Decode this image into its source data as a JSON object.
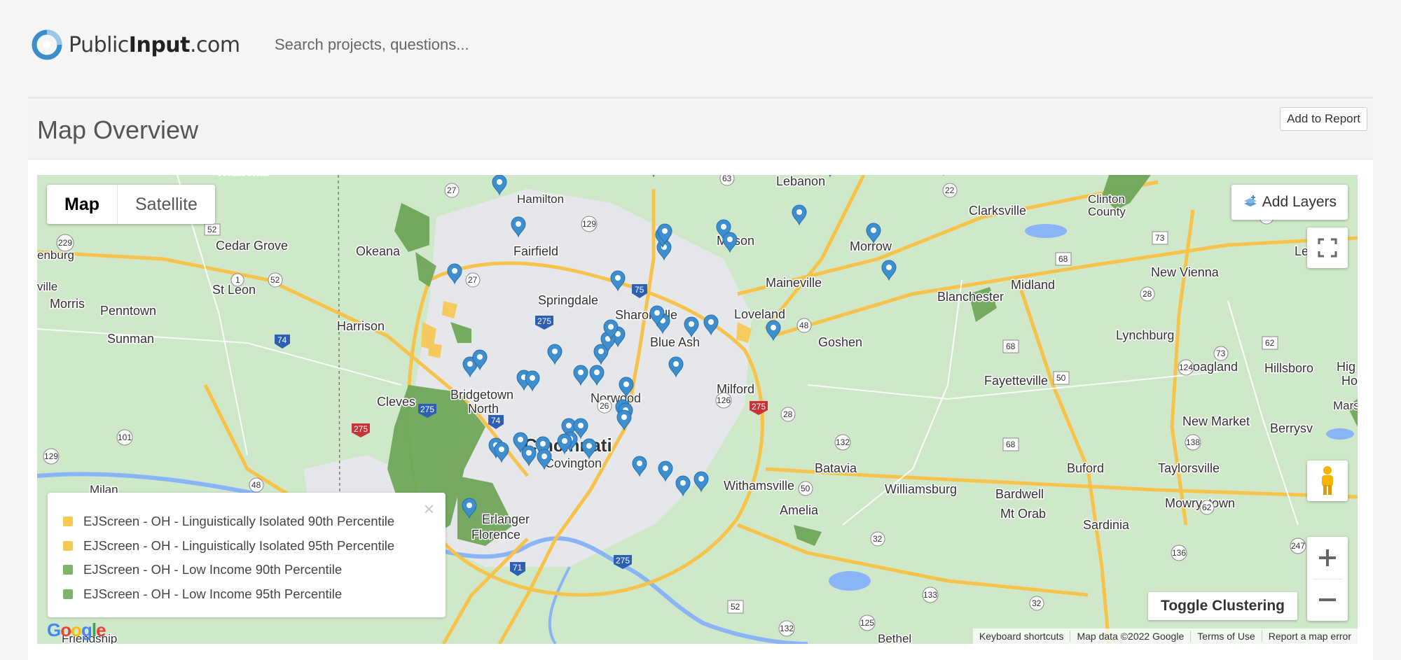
{
  "header": {
    "logo": {
      "prefix": "Public",
      "bold": "Input",
      "suffix": ".com"
    },
    "search_placeholder": "Search projects, questions..."
  },
  "card": {
    "title": "Map Overview",
    "add_to_report_label": "Add to Report"
  },
  "map": {
    "type_controls": {
      "map_label": "Map",
      "satellite_label": "Satellite",
      "active": "Map"
    },
    "add_layers_label": "Add Layers",
    "toggle_clustering_label": "Toggle Clustering",
    "zoom_in_icon": "plus-icon",
    "zoom_out_icon": "minus-icon",
    "fullscreen_icon": "fullscreen-icon",
    "pegman_icon": "pegman-icon",
    "legend": {
      "close_glyph": "×",
      "items": [
        {
          "label": "EJScreen - OH - Linguistically Isolated 90th Percentile",
          "color": "#f6c955"
        },
        {
          "label": "EJScreen - OH - Linguistically Isolated 95th Percentile",
          "color": "#f6c955"
        },
        {
          "label": "EJScreen - OH - Low Income 90th Percentile",
          "color": "#7fb26c"
        },
        {
          "label": "EJScreen - OH - Low Income 95th Percentile",
          "color": "#7fb26c"
        }
      ]
    },
    "attribution": {
      "logo": "Google",
      "keyboard_shortcuts": "Keyboard shortcuts",
      "map_data": "Map data ©2022 Google",
      "terms": "Terms of Use",
      "report": "Report a map error"
    },
    "places": [
      "Hamilton",
      "Lebanon",
      "Clarksville",
      "Clinton County",
      "Lees C",
      "Cedar Grove",
      "Okeana",
      "Fairfield",
      "Mason",
      "Morrow",
      "Leesb",
      "enburg",
      "St Leon",
      "Maineville",
      "New Vienna",
      "ville",
      "Morris",
      "Penntown",
      "Springdale",
      "Sharonville",
      "Loveland",
      "Blanchester",
      "Midland",
      "Harrison",
      "Sunman",
      "Blue Ash",
      "Goshen",
      "Lynchburg",
      "Hoagland",
      "Hillsboro",
      "Hig Ho",
      "Fayetteville",
      "Cleves",
      "Bridgetown North",
      "Norwood",
      "Milford",
      "Cincinnati",
      "Covington",
      "Milan",
      "Batavia",
      "New Market",
      "Berrysv",
      "Mars",
      "Withamsville",
      "Williamsburg",
      "Bardwell",
      "Buford",
      "Taylorsville",
      "Mowrystown",
      "Mt Orab",
      "Sardinia",
      "Amelia",
      "Erlanger",
      "Florence",
      "Friendship",
      "Bethel",
      "Whitcomb"
    ],
    "route_shields": [
      "27",
      "129",
      "63",
      "22",
      "52",
      "229",
      "1",
      "52",
      "27",
      "75",
      "68",
      "73",
      "72",
      "28",
      "74",
      "275",
      "48",
      "62",
      "126",
      "26",
      "124",
      "73",
      "50",
      "74",
      "275",
      "101",
      "28",
      "275",
      "132",
      "138",
      "129",
      "48",
      "50",
      "62",
      "32",
      "247",
      "275",
      "71",
      "275",
      "136",
      "52",
      "32",
      "133",
      "125",
      "132",
      "68"
    ],
    "marker_count": 52
  }
}
